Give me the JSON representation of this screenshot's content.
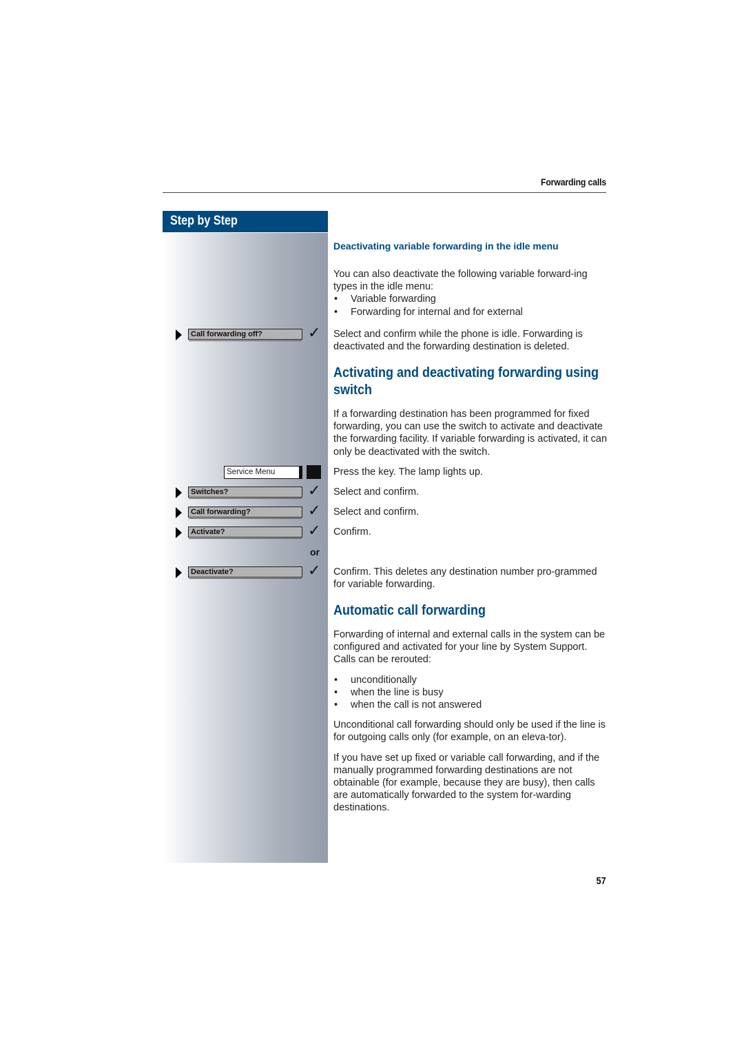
{
  "header": {
    "section_title": "Forwarding calls"
  },
  "sidebar": {
    "banner_title": "Step by Step",
    "steps": [
      {
        "display": "Call forwarding off?",
        "arrow": "triangle-right-icon",
        "action": "checkmark-icon"
      },
      {
        "display": "Switches?",
        "arrow": "triangle-right-icon",
        "action": "checkmark-icon"
      },
      {
        "display": "Call forwarding?",
        "arrow": "triangle-right-icon",
        "action": "checkmark-icon"
      },
      {
        "display": "Activate?",
        "arrow": "triangle-right-icon",
        "action": "checkmark-icon"
      },
      {
        "display": "Deactivate?",
        "arrow": "triangle-right-icon",
        "action": "checkmark-icon"
      }
    ],
    "service_menu_key": "Service Menu",
    "or_label": "or",
    "check_glyph": "✓"
  },
  "sections": {
    "idle_menu": {
      "heading": "Deactivating variable forwarding in the idle menu",
      "intro": "You can also deactivate the following variable forward-ing types in the idle menu:",
      "bullets": [
        "Variable forwarding",
        "Forwarding for internal and for external"
      ],
      "step_text": "Select and confirm while the phone is idle. Forwarding is deactivated and the forwarding destination is deleted."
    },
    "switch": {
      "heading": "Activating and deactivating forwarding using switch",
      "intro": "If a forwarding destination has been programmed for fixed forwarding, you can use the switch to activate and deactivate the forwarding facility. If variable forwarding is activated, it can only be deactivated with the switch.",
      "steps": [
        "Press the key. The lamp lights up.",
        "Select and confirm.",
        "Select and confirm.",
        "Confirm.",
        "Confirm. This deletes any destination number pro-grammed for variable forwarding."
      ]
    },
    "automatic": {
      "heading": "Automatic call forwarding",
      "intro": "Forwarding of internal and external calls in the system can be configured and activated for your line by System Support. Calls can be rerouted:",
      "bullets": [
        "unconditionally",
        "when the line is busy",
        "when the call is not answered"
      ],
      "para1": "Unconditional call forwarding should only be used if the line is for outgoing calls only (for example, on an eleva-tor).",
      "para2": "If you have set up fixed or variable call forwarding, and if the manually programmed forwarding destinations are not obtainable (for example, because they are busy), then calls are automatically forwarded to the system for-warding destinations."
    }
  },
  "footer": {
    "page_number": "57"
  },
  "colors": {
    "brand_blue": "#004a7f"
  }
}
